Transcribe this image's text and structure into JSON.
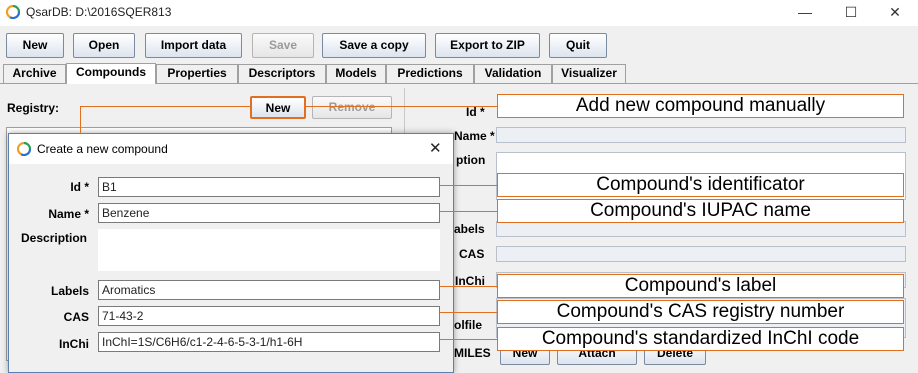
{
  "window": {
    "title": "QsarDB: D:\\2016SQER813",
    "minimize": "—",
    "maximize": "☐",
    "close": "✕"
  },
  "toolbar": [
    "New",
    "Open",
    "Import data",
    "Save",
    "Save a copy",
    "Export to ZIP",
    "Quit"
  ],
  "tabs": [
    "Archive",
    "Compounds",
    "Properties",
    "Descriptors",
    "Models",
    "Predictions",
    "Validation",
    "Visualizer"
  ],
  "main": {
    "registry_label": "Registry:",
    "new_button": "New",
    "remove_button": "Remove",
    "right_labels": {
      "id": "Id *",
      "name": "Name *",
      "description": "ption",
      "labels": "abels",
      "cas": "CAS",
      "inchi": "InChi",
      "molfile": "olfile",
      "smiles": "MILES"
    },
    "bottom_buttons": [
      "New",
      "Attach",
      "Delete"
    ]
  },
  "dialog": {
    "title": "Create a new compound",
    "close": "✕",
    "labels": {
      "id": "Id *",
      "name": "Name *",
      "description": "Description",
      "labels": "Labels",
      "cas": "CAS",
      "inchi": "InChi"
    },
    "values": {
      "id": "B1",
      "name": "Benzene",
      "description": "",
      "labels": "Aromatics",
      "cas": "71-43-2",
      "inchi": "InChI=1S/C6H6/c1-2-4-6-5-3-1/h1-6H"
    }
  },
  "annotations": {
    "add_new": "Add new compound manually",
    "identificator": "Compound's identificator",
    "iupac": "Compound's IUPAC name",
    "label": "Compound's label",
    "cas": "Compound's CAS registry number",
    "inchi": "Compound's standardized InChI code"
  },
  "colors": {
    "annotation": "#e07020",
    "dialog_border": "#5a7fb0"
  }
}
